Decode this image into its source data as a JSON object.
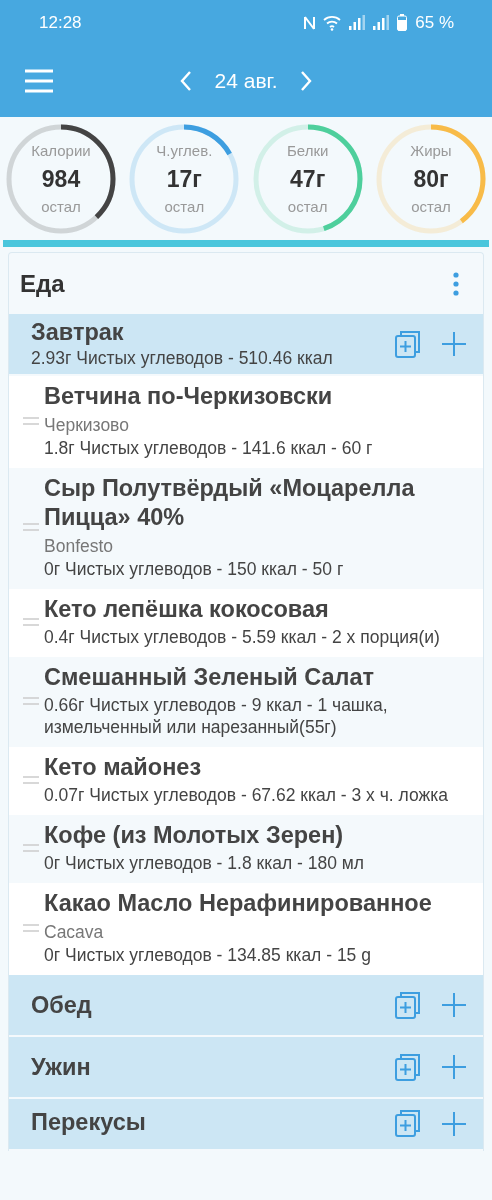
{
  "status_bar": {
    "time": "12:28",
    "battery": "65 %"
  },
  "app_bar": {
    "date": "24 авг."
  },
  "rings": [
    {
      "label": "Калории",
      "value": "984",
      "caption": "остал",
      "level": 0.38,
      "color": "#444444"
    },
    {
      "label": "Ч.углев.",
      "value": "17г",
      "caption": "остал",
      "level": 0.17,
      "color": "#3d9ee0"
    },
    {
      "label": "Белки",
      "value": "47г",
      "caption": "остал",
      "level": 0.45,
      "color": "#4ecf9c"
    },
    {
      "label": "Жиры",
      "value": "80г",
      "caption": "остал",
      "level": 0.4,
      "color": "#f8bb48"
    }
  ],
  "food": {
    "title": "Еда",
    "meals": [
      {
        "name": "Завтрак",
        "summary": "2.93г Чистых углеводов - 510.46 ккал",
        "items": [
          {
            "name": "Ветчина по-Черкизовски",
            "brand": "Черкизово",
            "details": "1.8г Чистых углеводов - 141.6 ккал - 60 г"
          },
          {
            "name": "Сыр Полутвёрдый «Моцарелла Пицца» 40%",
            "brand": "Bonfesto",
            "details": "0г Чистых углеводов - 150 ккал - 50 г"
          },
          {
            "name": "Кето лепёшка кокосовая",
            "details": "0.4г Чистых углеводов - 5.59 ккал - 2 x порция(и)"
          },
          {
            "name": "Смешанный Зеленый Салат",
            "details": "0.66г Чистых углеводов - 9 ккал - 1 чашка, измельченный или нарезанный(55г)"
          },
          {
            "name": "Кето майонез",
            "details": "0.07г Чистых углеводов - 67.62 ккал - 3 x ч. ложка"
          },
          {
            "name": "Кофе (из Молотых Зерен)",
            "details": "0г Чистых углеводов - 1.8 ккал - 180 мл"
          },
          {
            "name": "Какао Масло Нерафинированное",
            "brand": "Cacava",
            "details": "0г Чистых углеводов - 134.85 ккал - 15 g"
          }
        ]
      },
      {
        "name": "Обед"
      },
      {
        "name": "Ужин"
      },
      {
        "name": "Перекусы"
      }
    ]
  }
}
